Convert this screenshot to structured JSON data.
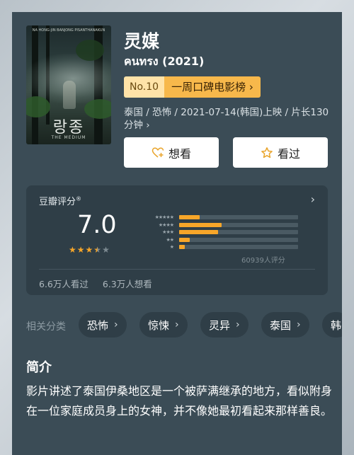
{
  "movie": {
    "title": "灵媒",
    "original_title": "คนทรง (2021)",
    "rank_no": "No.10",
    "rank_list": "一周口碑电影榜",
    "meta": "泰国 / 恐怖 / 2021-07-14(韩国)上映 / 片长130分钟"
  },
  "poster": {
    "title_text": "랑종",
    "top_text": "NA HONG-JIN BANJONG PISANTHANAKUN",
    "bottom_text": "THE MEDIUM"
  },
  "actions": {
    "want_label": "想看",
    "seen_label": "看过"
  },
  "rating": {
    "label": "豆瓣评分",
    "superscript": "®",
    "score": "7.0",
    "stars_filled": 3.5,
    "distribution": [
      {
        "stars": 5,
        "fraction": 0.17
      },
      {
        "stars": 4,
        "fraction": 0.36
      },
      {
        "stars": 3,
        "fraction": 0.33
      },
      {
        "stars": 2,
        "fraction": 0.09
      },
      {
        "stars": 1,
        "fraction": 0.05
      }
    ],
    "count_text": "60939人评分",
    "seen_text": "6.6万人看过",
    "want_text": "6.3万人想看"
  },
  "categories": {
    "label": "相关分类",
    "items": [
      "恐怖",
      "惊悚",
      "灵异",
      "泰国",
      "韩"
    ]
  },
  "intro": {
    "title": "简介",
    "text": "影片讲述了泰国伊桑地区是一个被萨满继承的地方，看似附身在一位家庭成员身上的女神，并不像她最初看起来那样善良。"
  },
  "colors": {
    "card_bg": "#3b4c56",
    "rating_bg": "#2f3e47",
    "accent_orange": "#f7a629",
    "rank_bg": "#f7b84b"
  }
}
